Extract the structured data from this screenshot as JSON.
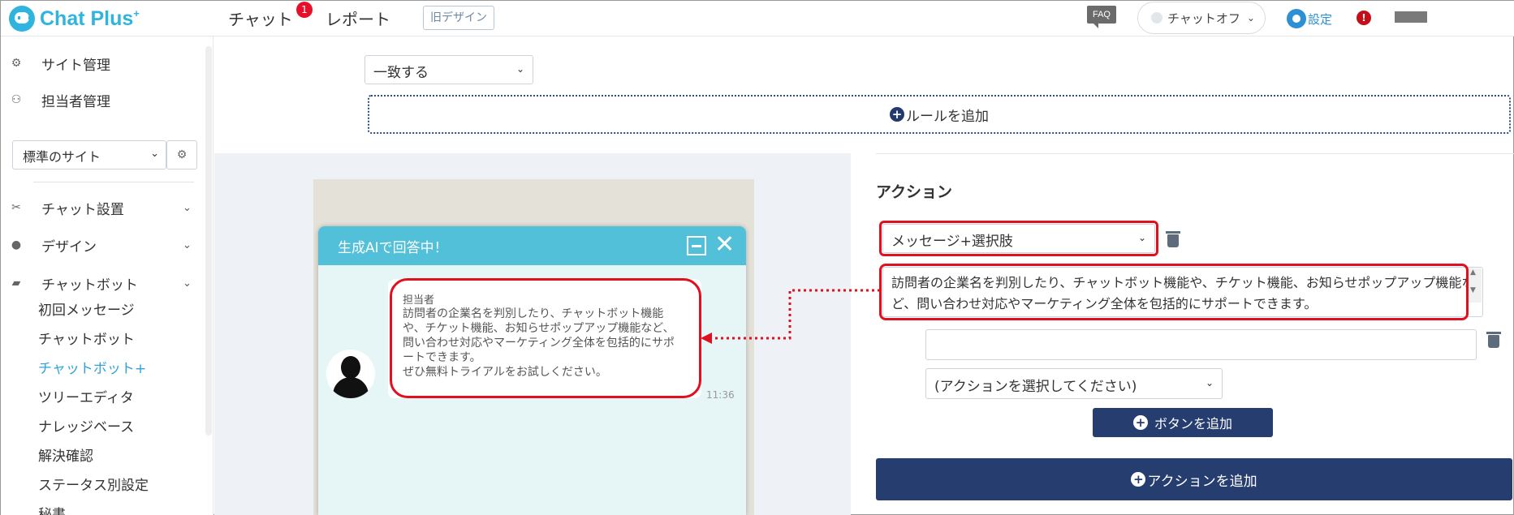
{
  "header": {
    "logo_text": "Chat Plus",
    "logo_sup": "+",
    "nav_chat": "チャット",
    "nav_chat_badge": "1",
    "nav_report": "レポート",
    "old_design": "旧デザイン",
    "faq": "FAQ",
    "chat_status": "チャットオフ",
    "settings": "設定",
    "alert": "!"
  },
  "sidebar": {
    "site_manage": "サイト管理",
    "staff_manage": "担当者管理",
    "site_select": "標準のサイト",
    "chat_install": "チャット設置",
    "design": "デザイン",
    "chatbot": "チャットボット",
    "sub_items": [
      "初回メッセージ",
      "チャットボット",
      "チャットボット+",
      "ツリーエディタ",
      "ナレッジベース",
      "解決確認",
      "ステータス別設定",
      "秘書"
    ]
  },
  "rules": {
    "match_value": "一致する",
    "add_rule": "ルールを追加"
  },
  "preview": {
    "widget_title": "生成AIで回答中！",
    "sender": "担当者",
    "message": "訪問者の企業名を判別したり、チャットボット機能や、チケット機能、お知らせポップアップ機能など、問い合わせ対応やマーケティング全体を包括的にサポートできます。\nぜひ無料トライアルをお試しください。",
    "time": "11:36"
  },
  "action": {
    "heading": "アクション",
    "type_value": "メッセージ+選択肢",
    "message_text": "訪問者の企業名を判別したり、チャットボット機能や、チケット機能、お知らせポップアップ機能など、問い合わせ対応やマーケティング全体を包括的にサポートできます。",
    "choice_value": "",
    "choice_action": "(アクションを選択してください)",
    "add_button": "ボタンを追加",
    "add_action": "アクションを追加"
  },
  "colors": {
    "brand": "#2fb4df",
    "primary_button": "#263d6f",
    "widget_header": "#52c0d9",
    "highlight_red": "#e0101e",
    "active_menu": "#2fa3d9"
  }
}
